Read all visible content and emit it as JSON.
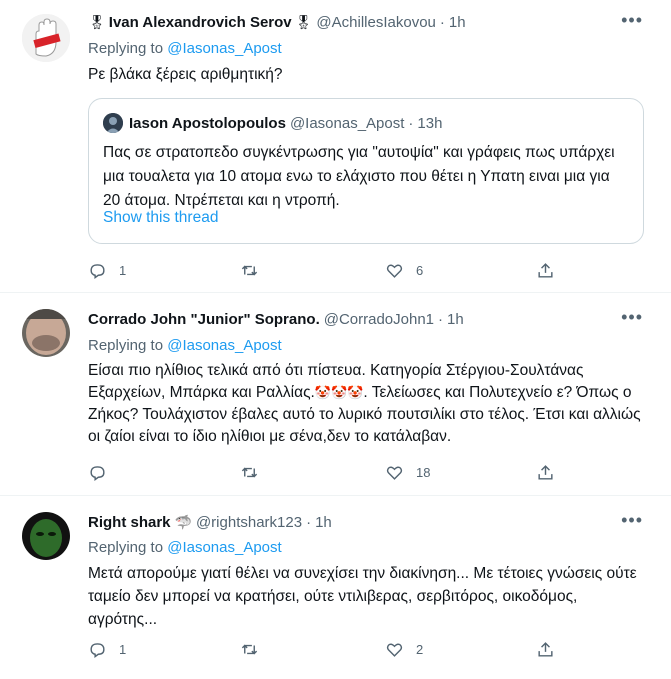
{
  "tweets": [
    {
      "display_name": "Ivan Alexandrovich Serov",
      "name_badge_left": "🎖",
      "name_badge_right": "🎖",
      "handle": "@AchillesIakovou",
      "time": "1h",
      "replying_prefix": "Replying to",
      "replying_handle": "@Iasonas_Apost",
      "text": "Ρε βλάκα ξέρεις αριθμητική?",
      "quote": {
        "display_name": "Iason Apostolopoulos",
        "handle": "@Iasonas_Apost",
        "time": "13h",
        "text": "Πας σε στρατοπεδο συγκέντρωσης για \"αυτοψία\" και γράφεις πως υπάρχει μια τουαλετα για 10 ατομα ενω το ελάχιστο που θέτει η Υπατη ειναι μια για 20 άτομα. Ντρέπεται και η ντροπή.",
        "show_thread": "Show this thread"
      },
      "replies": "1",
      "retweets": "",
      "likes": "6"
    },
    {
      "display_name": "Corrado John \"Junior\" Soprano.",
      "handle": "@CorradoJohn1",
      "time": "1h",
      "replying_prefix": "Replying to",
      "replying_handle": "@Iasonas_Apost",
      "text_part1": "Είσαι πιο ηλίθιος τελικά από ότι πίστευα. Κατηγορία Στέργιου-Σουλτάνας Εξαρχείων, Μπάρκα και Ραλλίας.",
      "text_emoji": "🤡🤡🤡",
      "text_part2": ". Τελείωσες και Πολυτεχνείο ε? Όπως ο Ζήκος? Τουλάχιστον έβαλες αυτό το λυρικό πουτσιλίκι στο τέλος. Έτσι και αλλιώς οι ζαίοι είναι το ίδιο ηλίθιοι με σένα,δεν το κατάλαβαν.",
      "replies": "",
      "retweets": "",
      "likes": "18"
    },
    {
      "display_name": "Right shark",
      "name_badge_right": "🦈",
      "handle": "@rightshark123",
      "time": "1h",
      "replying_prefix": "Replying to",
      "replying_handle": "@Iasonas_Apost",
      "text": "Μετά απορούμε γιατί θέλει να συνεχίσει την διακίνηση... Με τέτοιες γνώσεις ούτε ταμείο δεν μπορεί να κρατήσει, ούτε ντιλιβερας, σερβιτόρος, οικοδόμος, αγρότης...",
      "replies": "1",
      "retweets": "",
      "likes": "2"
    }
  ],
  "separator": "·",
  "colors": {
    "link": "#1d9bf0",
    "muted": "#536471",
    "border": "#cfd9de"
  }
}
